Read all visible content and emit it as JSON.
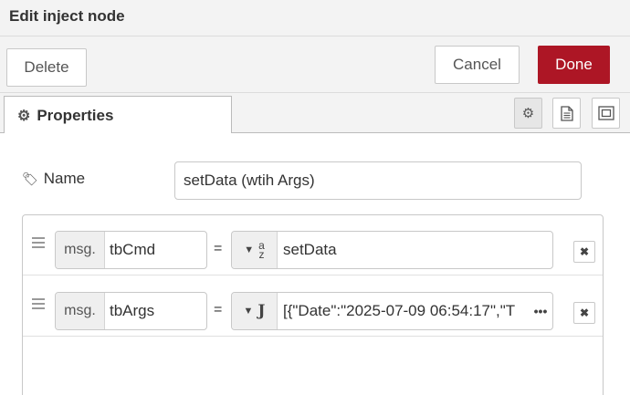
{
  "dialog": {
    "title": "Edit inject node"
  },
  "toolbar": {
    "delete_label": "Delete",
    "cancel_label": "Cancel",
    "done_label": "Done",
    "done_color": "#ad1625"
  },
  "tabs": {
    "properties_label": "Properties"
  },
  "form": {
    "name_label": "Name",
    "name_value": "setData (wtih Args)",
    "props": [
      {
        "prefix": "msg.",
        "property": "tbCmd",
        "equals": "=",
        "type_icon": "string-az-icon",
        "value": "setData"
      },
      {
        "prefix": "msg.",
        "property": "tbArgs",
        "equals": "=",
        "type_icon": "json-icon",
        "value": "[{\"Date\":\"2025-07-09 06:54:17\",\"T"
      }
    ]
  }
}
